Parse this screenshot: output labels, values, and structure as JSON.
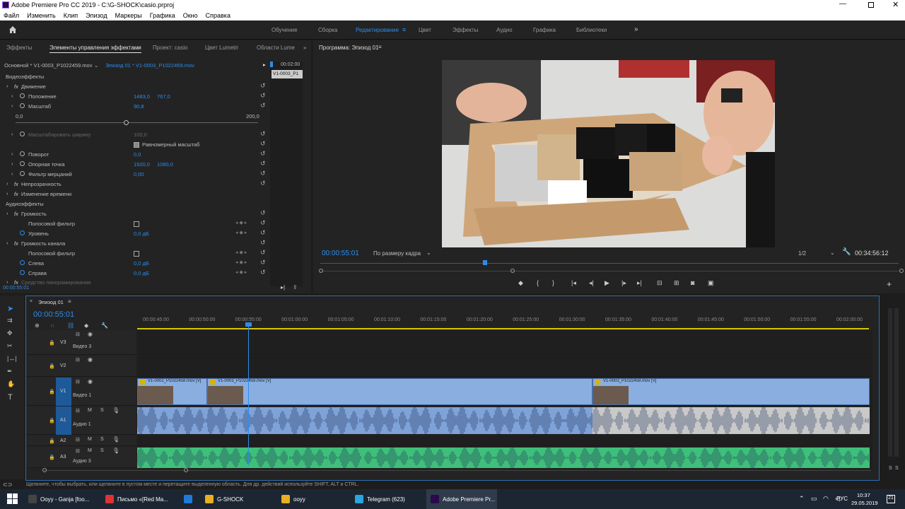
{
  "window": {
    "title": "Adobe Premiere Pro CC 2019 - C:\\G-SHOCK\\casio.prproj"
  },
  "menu": [
    "Файл",
    "Изменить",
    "Клип",
    "Эпизод",
    "Маркеры",
    "Графика",
    "Окно",
    "Справка"
  ],
  "workspaces": [
    {
      "label": "Обучение",
      "active": false
    },
    {
      "label": "Сборка",
      "active": false
    },
    {
      "label": "Редактирование",
      "active": true
    },
    {
      "label": "Цвет",
      "active": false
    },
    {
      "label": "Эффекты",
      "active": false
    },
    {
      "label": "Аудио",
      "active": false
    },
    {
      "label": "Графика",
      "active": false
    },
    {
      "label": "Библиотеки",
      "active": false
    }
  ],
  "left_tabs": {
    "t1": "Эффекты",
    "t2": "Элементы управления эффектами",
    "t3": "Проект: casio",
    "t4": "Цвет Lumetri",
    "t5": "Области Lume"
  },
  "effect_controls": {
    "source": "Основной * V1-0003_P1022459.mov",
    "clip": "Эпизод 01 * V1-0003_P1022459.mov",
    "mini_time": "00:02:00",
    "mini_clip": "V1-0003_P1",
    "video_effects": "Видеоэффекты",
    "motion": "Движение",
    "position_label": "Положение",
    "position_x": "1483,0",
    "position_y": "767,0",
    "scale_label": "Масштаб",
    "scale_value": "90,8",
    "slider_min": "0,0",
    "slider_max": "200,0",
    "scale_width_label": "Масштабировать ширину",
    "scale_width_value": "100,0",
    "uniform_scale": "Равномерный масштаб",
    "rotation_label": "Поворот",
    "rotation_value": "0,0",
    "anchor_label": "Опорная точка",
    "anchor_x": "1920,0",
    "anchor_y": "1080,0",
    "flicker_label": "Фильтр мерцаний",
    "flicker_value": "0,00",
    "opacity": "Непрозрачность",
    "time_remap": "Изменение времени",
    "audio_effects": "Аудиоэффекты",
    "volume": "Громкость",
    "bypass": "Полосовой фильтр",
    "level_label": "Уровень",
    "level_value": "0,0 дБ",
    "channel_volume": "Громкость канала",
    "bypass2": "Полосовой фильтр",
    "left_label": "Слева",
    "left_value": "0,0 дБ",
    "right_label": "Справа",
    "right_value": "0,0 дБ",
    "panner": "Средство панорамирования",
    "timecode": "00:00:55:01"
  },
  "program": {
    "title": "Программа: Эпизод 01",
    "timecode": "00:00:55:01",
    "fit": "По размеру кадра",
    "resolution": "1/2",
    "duration": "00:34:56:12"
  },
  "timeline": {
    "tab": "Эпизод 01",
    "timecode": "00:00:55:01",
    "ruler": [
      "00:00:45:00",
      "00:00:50:00",
      "00:00:55:00",
      "00:01:00:00",
      "00:01:05:00",
      "00:01:10:00",
      "00:01:15:00",
      "00:01:20:00",
      "00:01:25:00",
      "00:01:30:00",
      "00:01:35:00",
      "00:01:40:00",
      "00:01:45:00",
      "00:01:50:00",
      "00:01:55:00",
      "00:02:00:00"
    ],
    "v3": "V3",
    "v3_name": "Видео 3",
    "v2": "V2",
    "v1": "V1",
    "v1_name": "Видео 1",
    "a1": "A1",
    "a1_name": "Аудио 1",
    "a2": "A2",
    "a3": "A3",
    "a3_name": "Аудио 3",
    "clip1": "V1-0002_P1022458.mov [V]",
    "clip2": "V1-0003_P1022459.mov [V]",
    "clip3": "V1-0003_P1022459.mov [V]",
    "m": "M",
    "s": "S"
  },
  "status": "Щелкните, чтобы выбрать, или щелкните в пустом месте и перетащите выделенную область. Для др. действий используйте SHIFT, ALT и CTRL.",
  "taskbar": {
    "items": [
      "Ooyy - Ganja  [foo...",
      "Письмо «[Red Ma...",
      "",
      "G-SHOCK",
      "ooyy",
      "Telegram (623)",
      "Adobe Premiere Pr..."
    ],
    "lang": "РУС",
    "time": "10:37",
    "date": "29.05.2019",
    "notif": "21"
  }
}
